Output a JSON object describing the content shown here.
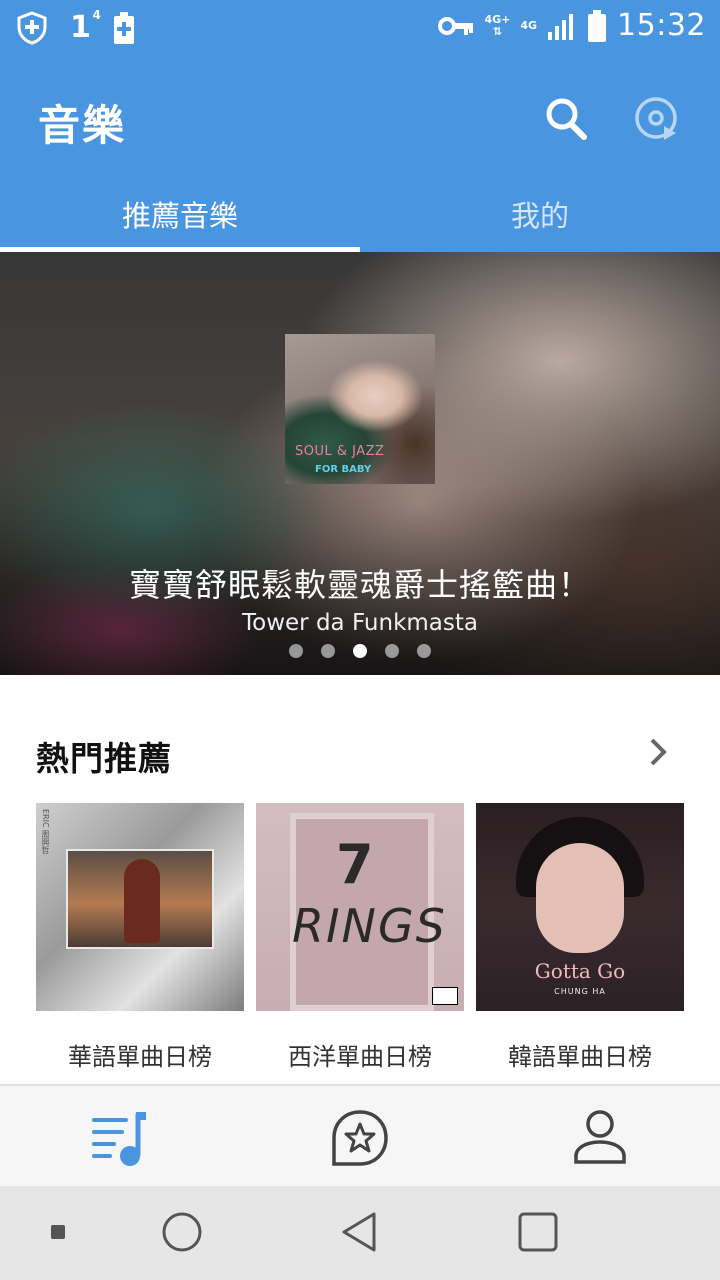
{
  "status_bar": {
    "notification_count": "1",
    "notification_sup": "4",
    "network_top": "4G+",
    "network_second": "4G",
    "time": "15:32"
  },
  "app_bar": {
    "title": "音樂"
  },
  "tabs": [
    {
      "label": "推薦音樂",
      "active": true
    },
    {
      "label": "我的",
      "active": false
    }
  ],
  "banner": {
    "album_text_1": "SOUL & JAZZ",
    "album_text_2": "FOR BABY",
    "title": "寶寶舒眠鬆軟靈魂爵士搖籃曲！",
    "artist": "Tower da Funkmasta",
    "page_count": 5,
    "active_page": 3
  },
  "hot_section": {
    "title": "熱門推薦",
    "cards": [
      {
        "label": "華語單曲日榜",
        "cover_side_text": "ERIC 周興哲"
      },
      {
        "label": "西洋單曲日榜",
        "cover_text_1": "7",
        "cover_text_2": "RINGS"
      },
      {
        "label": "韓語單曲日榜",
        "cover_text_1": "Gotta Go",
        "cover_text_2": "CHUNG HA"
      }
    ]
  },
  "bottom_nav": {
    "items": [
      "music-list-icon",
      "star-chat-icon",
      "user-icon"
    ],
    "active_color": "#4a95e0",
    "inactive_color": "#444444"
  },
  "colors": {
    "primary": "#4a95e0"
  }
}
